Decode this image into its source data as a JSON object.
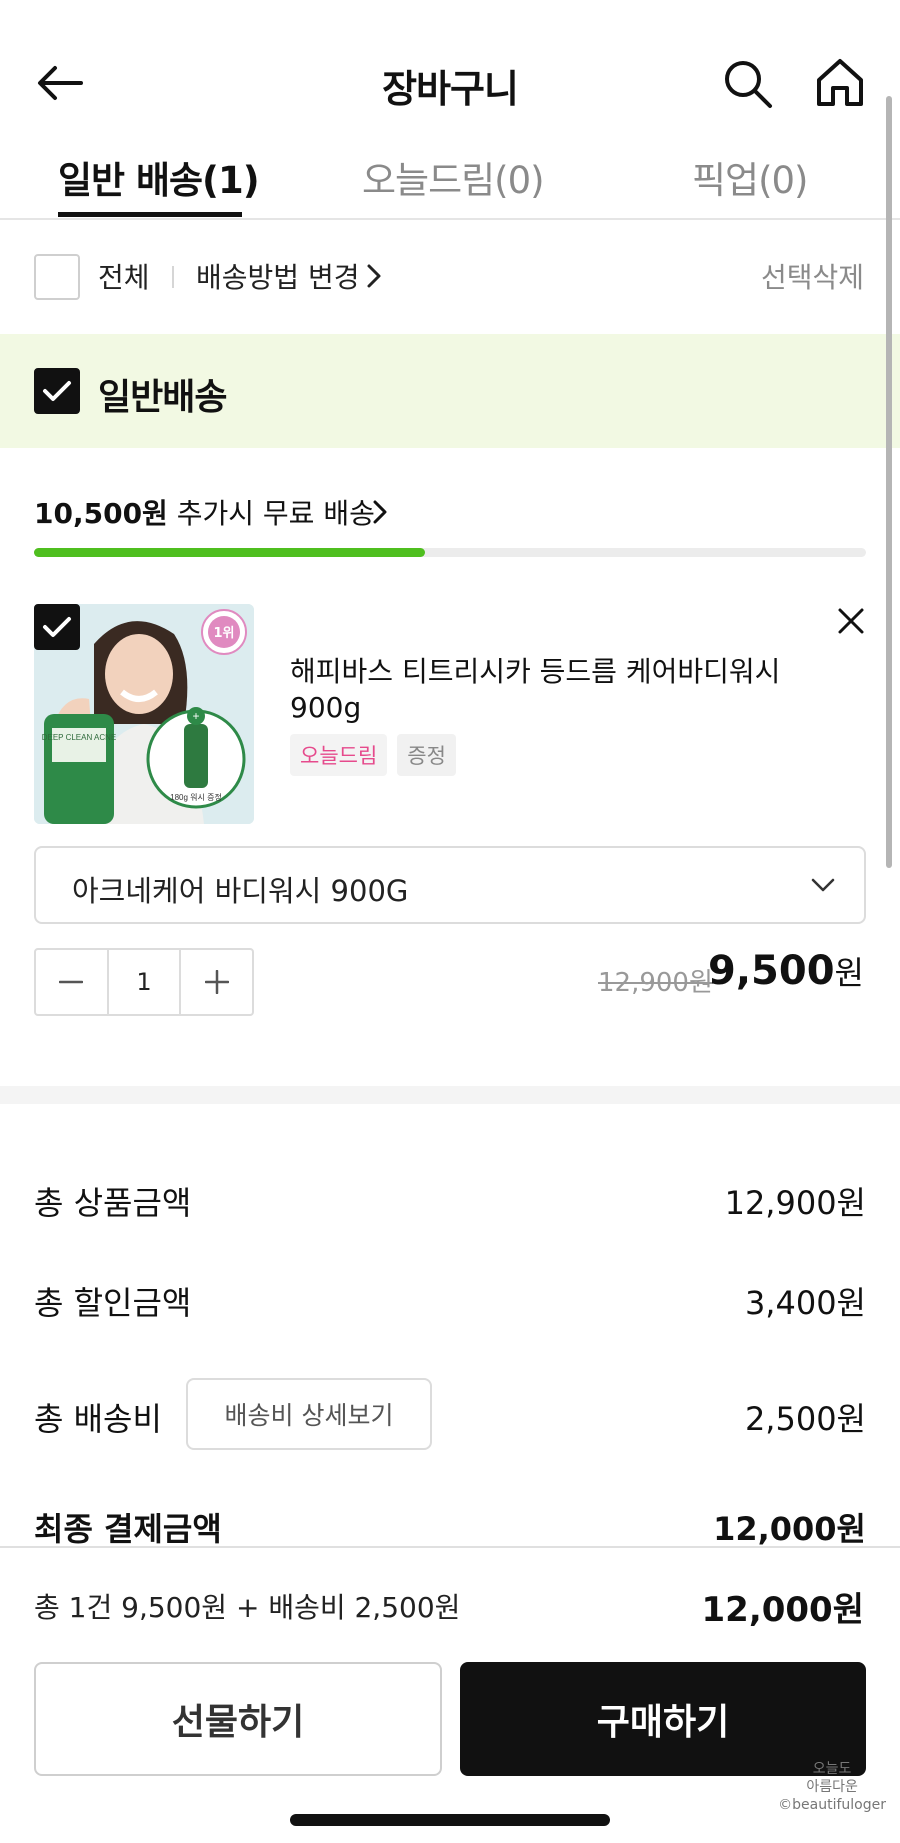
{
  "header": {
    "title": "장바구니"
  },
  "tabs": [
    {
      "label": "일반 배송(1)",
      "active": true
    },
    {
      "label": "오늘드림(0)",
      "active": false
    },
    {
      "label": "픽업(0)",
      "active": false
    }
  ],
  "select_row": {
    "all_label": "전체",
    "change_method": "배송방법 변경",
    "delete_selected": "선택삭제"
  },
  "group": {
    "label": "일반배송"
  },
  "free_shipping": {
    "amount": "10,500원",
    "suffix": " 추가시 무료 배송",
    "progress": 0.47,
    "accent": "#4fbf1f"
  },
  "product": {
    "name": "해피바스 티트리시카 등드름 케어바디워시 900g",
    "badges": [
      "오늘드림",
      "증정"
    ],
    "image_texts": {
      "rank": "1위",
      "bottle": "DEEP CLEAN ACNE",
      "gift": "180g 워시 증정"
    },
    "option": "아크네케어 바디워시 900G",
    "quantity": "1",
    "original_price": "12,900원",
    "sale_price": "9,500",
    "sale_unit": "원"
  },
  "summary": {
    "total_product_label": "총 상품금액",
    "total_product_value": "12,900원",
    "total_discount_label": "총 할인금액",
    "total_discount_value": "3,400원",
    "shipping_label": "총 배송비",
    "shipping_detail_button": "배송비 상세보기",
    "shipping_value": "2,500원",
    "final_label": "최종 결제금액",
    "final_value": "12,000원"
  },
  "bottom_bar": {
    "summary_text": "총 1건 9,500원 + 배송비 2,500원",
    "total": "12,000원",
    "gift_button": "선물하기",
    "buy_button": "구매하기"
  },
  "watermark": {
    "line1": "오늘도",
    "line2": "아름다운",
    "line3": "©beautifuloger"
  }
}
